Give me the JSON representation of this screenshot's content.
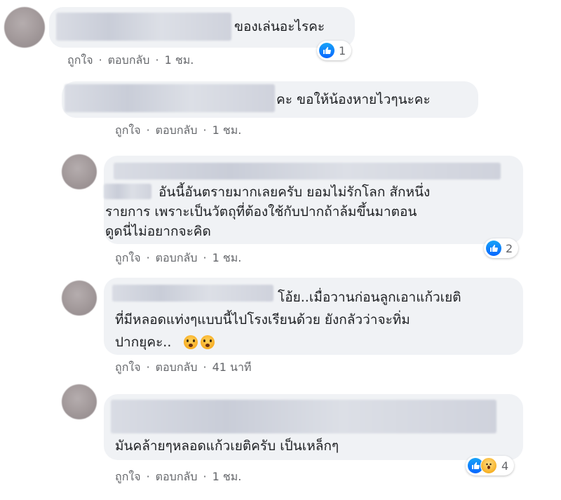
{
  "colors": {
    "bubble_bg": "#f0f2f5",
    "action_text": "#65676b",
    "like_blue": "#0866ff",
    "wow_yellow": "#f7b125"
  },
  "comments": [
    {
      "text_lines": [
        "ของเล่นอะไรคะ"
      ],
      "actions": {
        "like": "ถูกใจ",
        "reply": "ตอบกลับ",
        "time": "1 ชม."
      },
      "reaction": {
        "icons": [
          "like-icon"
        ],
        "count": "1"
      }
    },
    {
      "text_lines": [
        "คะ ขอให้น้องหายไวๆนะคะ"
      ],
      "actions": {
        "like": "ถูกใจ",
        "reply": "ตอบกลับ",
        "time": "1 ชม."
      }
    },
    {
      "text_lines": [
        "อันนี้อันตรายมากเลยครับ ยอมไม่รักโลก สักหนึ่ง",
        "รายการ เพราะเป็นวัตถุที่ต้องใช้กับปากถ้าล้มขึ้นมาตอน",
        "ดูดนี่ไม่อยากจะคิด"
      ],
      "actions": {
        "like": "ถูกใจ",
        "reply": "ตอบกลับ",
        "time": "1 ชม."
      },
      "reaction": {
        "icons": [
          "like-icon"
        ],
        "count": "2"
      }
    },
    {
      "text_lines": [
        "โอ้ย..เมื่อวานก่อนลูกเอาแก้วเยติ",
        "ที่มีหลอดแท่งๆแบบนี้ไปโรงเรียนด้วย ยังกลัวว่าจะทิ่ม",
        "ปากยุคะ.."
      ],
      "actions": {
        "like": "ถูกใจ",
        "reply": "ตอบกลับ",
        "time": "41 นาที"
      }
    },
    {
      "text_lines": [
        "มันคล้ายๆหลอดแก้วเยติครับ เป็นเหล็กๆ"
      ],
      "actions": {
        "like": "ถูกใจ",
        "reply": "ตอบกลับ",
        "time": "1 ชม."
      },
      "reaction": {
        "icons": [
          "like-icon",
          "wow-icon"
        ],
        "count": "4"
      }
    }
  ]
}
